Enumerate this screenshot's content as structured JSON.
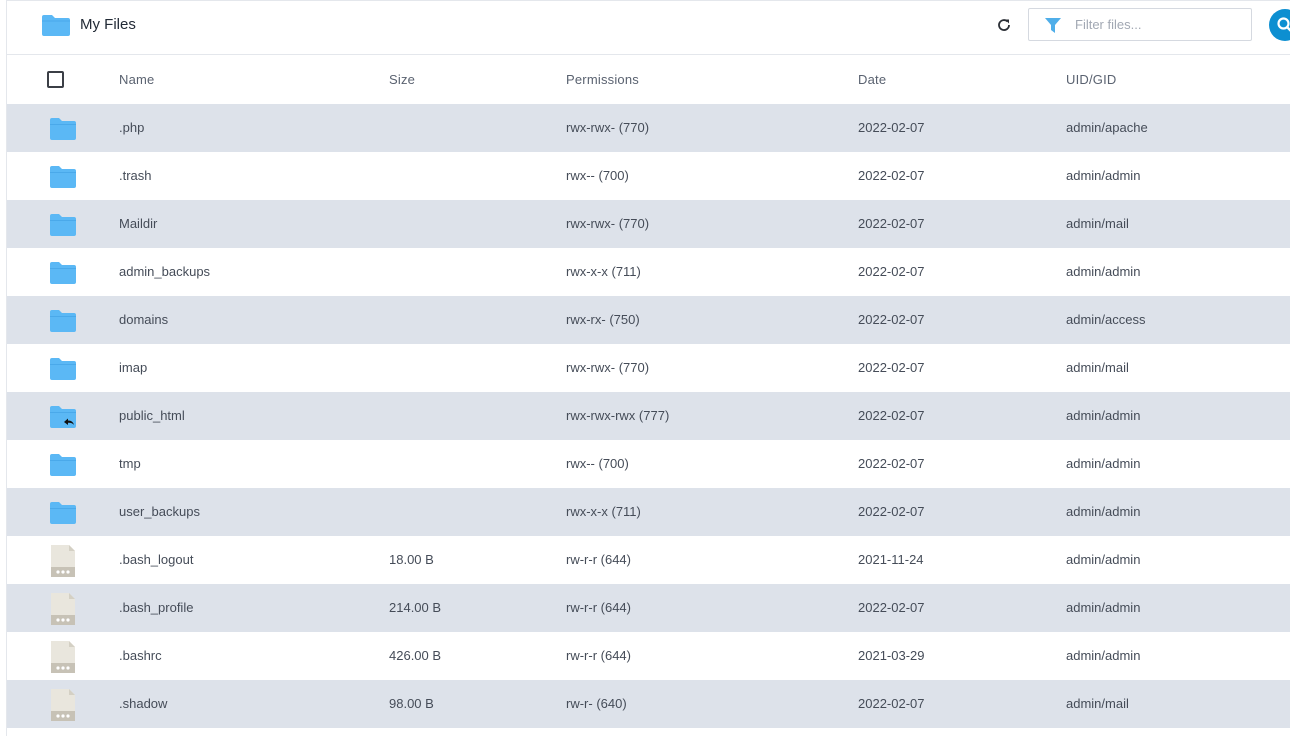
{
  "breadcrumb": {
    "label": "My Files",
    "icon": "folder-icon"
  },
  "toolbar": {
    "refresh_icon": "refresh-icon",
    "filter_icon": "filter-icon",
    "filter_placeholder": "Filter files...",
    "filter_value": "",
    "search_icon": "search-icon"
  },
  "columns": {
    "name": "Name",
    "size": "Size",
    "permissions": "Permissions",
    "date": "Date",
    "uid": "UID/GID"
  },
  "colors": {
    "folder": "#5bb8f5",
    "accent": "#0d8fd1",
    "row_shade": "#dde2ea"
  },
  "files": [
    {
      "type": "folder",
      "name": ".php",
      "size": "",
      "permissions": "rwx-rwx- (770)",
      "date": "2022-02-07",
      "uid": "admin/apache"
    },
    {
      "type": "folder",
      "name": ".trash",
      "size": "",
      "permissions": "rwx-- (700)",
      "date": "2022-02-07",
      "uid": "admin/admin"
    },
    {
      "type": "folder",
      "name": "Maildir",
      "size": "",
      "permissions": "rwx-rwx- (770)",
      "date": "2022-02-07",
      "uid": "admin/mail"
    },
    {
      "type": "folder",
      "name": "admin_backups",
      "size": "",
      "permissions": "rwx-x-x (711)",
      "date": "2022-02-07",
      "uid": "admin/admin"
    },
    {
      "type": "folder",
      "name": "domains",
      "size": "",
      "permissions": "rwx-rx- (750)",
      "date": "2022-02-07",
      "uid": "admin/access"
    },
    {
      "type": "folder",
      "name": "imap",
      "size": "",
      "permissions": "rwx-rwx- (770)",
      "date": "2022-02-07",
      "uid": "admin/mail"
    },
    {
      "type": "folder-link",
      "name": "public_html",
      "size": "",
      "permissions": "rwx-rwx-rwx (777)",
      "date": "2022-02-07",
      "uid": "admin/admin"
    },
    {
      "type": "folder",
      "name": "tmp",
      "size": "",
      "permissions": "rwx-- (700)",
      "date": "2022-02-07",
      "uid": "admin/admin"
    },
    {
      "type": "folder",
      "name": "user_backups",
      "size": "",
      "permissions": "rwx-x-x (711)",
      "date": "2022-02-07",
      "uid": "admin/admin"
    },
    {
      "type": "file",
      "name": ".bash_logout",
      "size": "18.00 B",
      "permissions": "rw-r-r (644)",
      "date": "2021-11-24",
      "uid": "admin/admin"
    },
    {
      "type": "file",
      "name": ".bash_profile",
      "size": "214.00 B",
      "permissions": "rw-r-r (644)",
      "date": "2022-02-07",
      "uid": "admin/admin"
    },
    {
      "type": "file",
      "name": ".bashrc",
      "size": "426.00 B",
      "permissions": "rw-r-r (644)",
      "date": "2021-03-29",
      "uid": "admin/admin"
    },
    {
      "type": "file",
      "name": ".shadow",
      "size": "98.00 B",
      "permissions": "rw-r- (640)",
      "date": "2022-02-07",
      "uid": "admin/mail"
    }
  ]
}
